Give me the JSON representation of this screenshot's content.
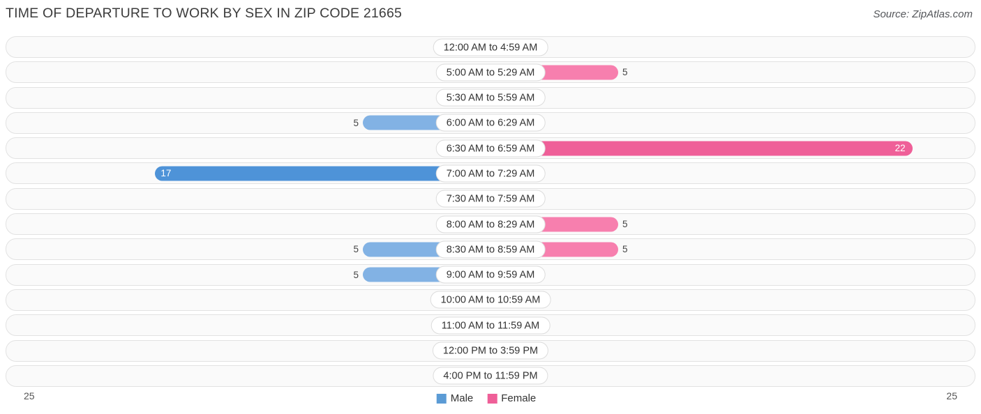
{
  "header": {
    "title": "TIME OF DEPARTURE TO WORK BY SEX IN ZIP CODE 21665",
    "source": "Source: ZipAtlas.com"
  },
  "axis": {
    "left_label": "25",
    "right_label": "25"
  },
  "legend": {
    "male": "Male",
    "female": "Female"
  },
  "chart_data": {
    "type": "bar",
    "orientation": "horizontal-diverging",
    "title": "TIME OF DEPARTURE TO WORK BY SEX IN ZIP CODE 21665",
    "xlabel": "",
    "ylabel": "",
    "xlim": [
      25,
      25
    ],
    "grid": false,
    "legend_position": "bottom-center",
    "categories": [
      "12:00 AM to 4:59 AM",
      "5:00 AM to 5:29 AM",
      "5:30 AM to 5:59 AM",
      "6:00 AM to 6:29 AM",
      "6:30 AM to 6:59 AM",
      "7:00 AM to 7:29 AM",
      "7:30 AM to 7:59 AM",
      "8:00 AM to 8:29 AM",
      "8:30 AM to 8:59 AM",
      "9:00 AM to 9:59 AM",
      "10:00 AM to 10:59 AM",
      "11:00 AM to 11:59 AM",
      "12:00 PM to 3:59 PM",
      "4:00 PM to 11:59 PM"
    ],
    "series": [
      {
        "name": "Male",
        "color": "#5b9bd5",
        "values": [
          0,
          0,
          0,
          5,
          0,
          17,
          0,
          0,
          5,
          5,
          0,
          0,
          0,
          0
        ]
      },
      {
        "name": "Female",
        "color": "#ef5f98",
        "values": [
          0,
          5,
          0,
          0,
          22,
          0,
          0,
          5,
          5,
          0,
          0,
          0,
          0,
          0
        ]
      }
    ]
  }
}
